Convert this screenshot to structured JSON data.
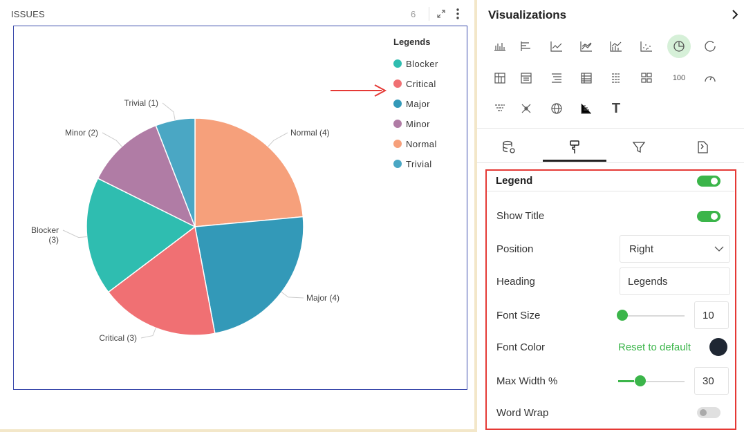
{
  "widget": {
    "title": "ISSUES",
    "count": "6",
    "expand_icon": "expand-icon",
    "more_icon": "more-vertical-icon"
  },
  "chart_data": {
    "type": "pie",
    "title": "",
    "legend_title": "Legends",
    "legend_position": "right",
    "slices": [
      {
        "label": "Normal",
        "value": 4,
        "color": "#f6a07b",
        "data_label": "Normal (4)"
      },
      {
        "label": "Major",
        "value": 4,
        "color": "#3399b8",
        "data_label": "Major (4)"
      },
      {
        "label": "Critical",
        "value": 3,
        "color": "#f07073",
        "data_label": "Critical (3)"
      },
      {
        "label": "Blocker",
        "value": 3,
        "color": "#2fbdb0",
        "data_label": "Blocker (3)"
      },
      {
        "label": "Minor",
        "value": 2,
        "color": "#b07ca5",
        "data_label": "Minor (2)"
      },
      {
        "label": "Trivial",
        "value": 1,
        "color": "#4aa7c4",
        "data_label": "Trivial (1)"
      }
    ],
    "legend_items": [
      {
        "label": "Blocker",
        "color": "#2fbdb0"
      },
      {
        "label": "Critical",
        "color": "#f07073"
      },
      {
        "label": "Major",
        "color": "#3399b8"
      },
      {
        "label": "Minor",
        "color": "#b07ca5"
      },
      {
        "label": "Normal",
        "color": "#f6a07b"
      },
      {
        "label": "Trivial",
        "color": "#4aa7c4"
      }
    ]
  },
  "annotation": {
    "arrow_color": "#e53935"
  },
  "visualizations": {
    "title": "Visualizations",
    "icons": [
      "column-chart-icon",
      "bar-chart-icon",
      "line-chart-icon",
      "area-chart-icon",
      "combo-chart-icon",
      "scatter-chart-icon",
      "pie-chart-icon",
      "doughnut-chart-icon",
      "pivot-table-icon",
      "table-icon",
      "tree-table-icon",
      "grid-icon",
      "list-icon",
      "card-grid-icon",
      "number-icon",
      "gauge-icon",
      "funnel-icon",
      "network-icon",
      "globe-icon",
      "bar-line-icon",
      "text-icon"
    ],
    "number_icon_text": "100",
    "text_icon_text": "T",
    "active": "pie-chart-icon"
  },
  "tabs": [
    "data-source-icon",
    "format-brush-icon",
    "filter-icon",
    "conditional-format-icon"
  ],
  "active_tab": "format-brush-icon",
  "legend_settings": {
    "section_label": "Legend",
    "section_enabled": true,
    "show_title_label": "Show Title",
    "show_title": true,
    "position_label": "Position",
    "position_value": "Right",
    "heading_label": "Heading",
    "heading_value": "Legends",
    "font_size_label": "Font Size",
    "font_size_value": "10",
    "font_size_level": 0.0,
    "font_color_label": "Font Color",
    "font_color_reset": "Reset to default",
    "font_color_value": "#1f2733",
    "max_width_label": "Max Width %",
    "max_width_value": "30",
    "max_width_level": 0.3,
    "word_wrap_label": "Word Wrap",
    "word_wrap": false
  },
  "colors": {
    "accent": "#3bb54a",
    "highlight_border": "#e53935",
    "chart_border": "#3949ab"
  }
}
